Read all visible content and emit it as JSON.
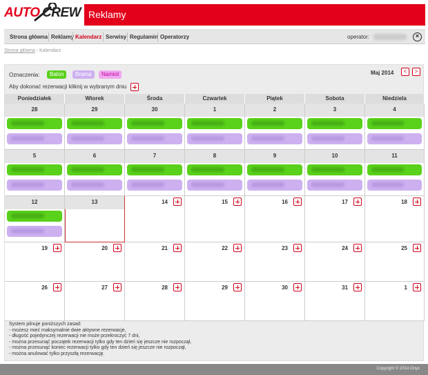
{
  "logo": {
    "auto": "AUTO",
    "crew": "CREW"
  },
  "header": {
    "title": "Reklamy"
  },
  "nav": {
    "items": [
      {
        "label": "Strona główna",
        "active": false
      },
      {
        "label": "Reklamy",
        "active": false
      },
      {
        "label": "Kalendarz",
        "active": true
      },
      {
        "label": "Serwisy",
        "active": false
      },
      {
        "label": "Regulamin",
        "active": false
      },
      {
        "label": "Operatorzy",
        "active": false
      }
    ],
    "operator_label": "operator:"
  },
  "breadcrumb": {
    "home": "Strona główna",
    "sep": "›",
    "current": "Kalendarz"
  },
  "legend": {
    "label": "Oznaczenia:",
    "items": [
      "Balon",
      "Brama",
      "Namiot"
    ],
    "hint": "Aby dokonać rezerwacji kliknij w wybranym dniu"
  },
  "calendar": {
    "month": "Maj 2014",
    "prev": "<",
    "next": ">",
    "weekdays": [
      "Poniedziałek",
      "Wtorek",
      "Środa",
      "Czwartek",
      "Piątek",
      "Sobota",
      "Niedziela"
    ],
    "weeks": [
      [
        "28",
        "29",
        "30",
        "1",
        "2",
        "3",
        "4"
      ],
      [
        "5",
        "6",
        "7",
        "8",
        "9",
        "10",
        "11"
      ],
      [
        "12",
        "13",
        "14",
        "15",
        "16",
        "17",
        "18"
      ],
      [
        "19",
        "20",
        "21",
        "22",
        "23",
        "24",
        "25"
      ],
      [
        "26",
        "27",
        "28",
        "29",
        "30",
        "31",
        "1"
      ]
    ]
  },
  "rules": [
    "System pilnuje poniższych zasad:",
    "- możesz mieć maksymalnie dwie aktywne rezerwacje,",
    "- długość pojedynczej rezerwacji nie może przekroczyć 7 dni,",
    "- można przesunąć początek rezerwacji tylko gdy ten dzień się jeszcze nie rozpoczął,",
    "- można przesunąć koniec rezerwacji tylko gdy ten dzień się jeszcze nie rozpoczął,",
    "- można anulować tylko przyszłą rezerwację."
  ],
  "footer": {
    "copyright": "Copyright © 2014 Onyx"
  },
  "colors": {
    "brand": "#e3001b",
    "balon": "#5ad11b",
    "brama": "#cdb0f0",
    "namiot": "#f1a8f0"
  }
}
